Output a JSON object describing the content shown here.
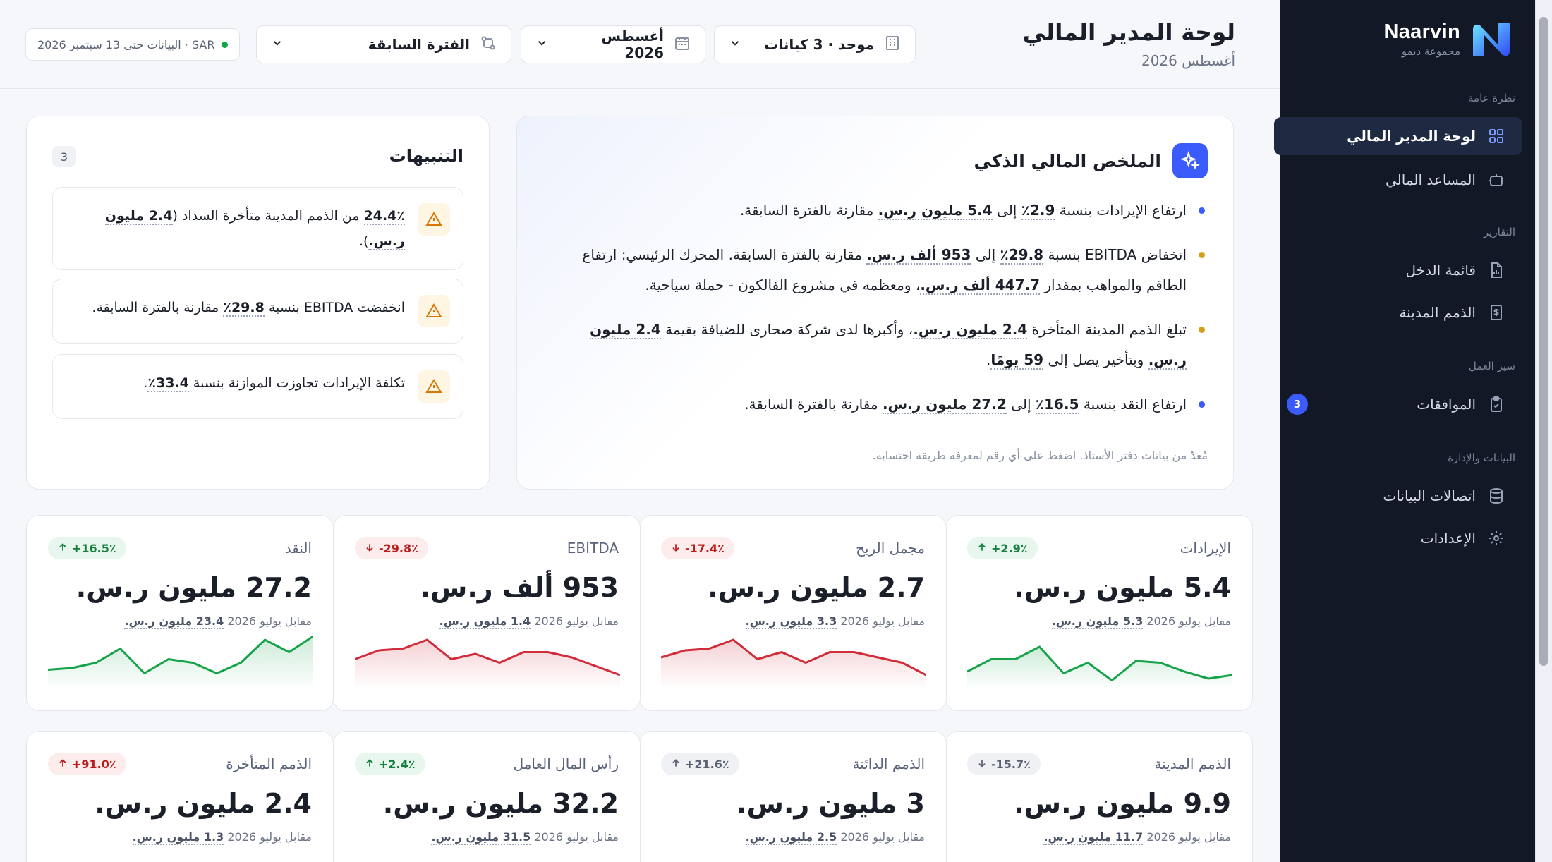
{
  "brand": {
    "name": "Naarvin",
    "subtitle": "مجموعة ديمو"
  },
  "sidebar": {
    "sections": [
      "نظرة عامة",
      "التقارير",
      "سير العمل",
      "البيانات والإدارة"
    ],
    "items": [
      {
        "label": "لوحة المدير المالي",
        "icon": "dashboard-grid-icon"
      },
      {
        "label": "المساعد المالي",
        "icon": "robot-icon"
      },
      {
        "label": "قائمة الدخل",
        "icon": "document-icon"
      },
      {
        "label": "الذمم المدينة",
        "icon": "invoice-icon"
      },
      {
        "label": "الموافقات",
        "icon": "clipboard-check-icon",
        "badge": "3"
      },
      {
        "label": "اتصالات البيانات",
        "icon": "database-icon"
      },
      {
        "label": "الإعدادات",
        "icon": "gear-icon"
      }
    ]
  },
  "header": {
    "title": "لوحة المدير المالي",
    "subtitle": "أغسطس 2026",
    "entity_select": "موحد · 3 كيانات",
    "period_select": "أغسطس 2026",
    "compare_select": "الفترة السابقة",
    "status": "البيانات حتى 13 سبتمبر 2026 · SAR"
  },
  "summary": {
    "title": "الملخص المالي الذكي",
    "items": [
      {
        "color": "#3b5bfd",
        "pre": "ارتفاع الإيرادات بنسبة ",
        "b1": "2.9٪",
        "mid1": " إلى ",
        "b2": "5.4 مليون ر.س.",
        "post": " مقارنة بالفترة السابقة."
      },
      {
        "color": "#d4a017",
        "pre": "انخفاض EBITDA بنسبة ",
        "b1": "29.8٪",
        "mid1": " إلى ",
        "b2": "953 ألف ر.س.",
        "post": " مقارنة بالفترة السابقة. المحرك الرئيسي: ارتفاع الطاقم والمواهب بمقدار ",
        "b3": "447.7 ألف ر.س.",
        "post2": "، ومعظمه في مشروع الفالكون - حملة سياحية."
      },
      {
        "color": "#d4a017",
        "pre": "تبلغ الذمم المدينة المتأخرة ",
        "b1": "2.4 مليون ر.س.",
        "mid1": "، وأكبرها لدى شركة صحارى للضيافة بقيمة ",
        "b2": "2.4 مليون ر.س.",
        "post": " وبتأخير يصل إلى ",
        "b3": "59 يومًا",
        "post2": "."
      },
      {
        "color": "#3b5bfd",
        "pre": "ارتفاع النقد بنسبة ",
        "b1": "16.5٪",
        "mid1": " إلى ",
        "b2": "27.2 مليون ر.س.",
        "post": " مقارنة بالفترة السابقة."
      }
    ],
    "footnote": "مُعدّ من بيانات دفتر الأستاذ. اضغط على أي رقم لمعرفة طريقة احتسابه."
  },
  "alerts": {
    "title": "التنبيهات",
    "count": "3",
    "items": [
      {
        "b": "24.4٪",
        "t1": " من الذمم المدينة متأخرة السداد (",
        "b2": "2.4 مليون ر.س.",
        "t2": ")."
      },
      {
        "t0": "انخفضت EBITDA بنسبة ",
        "b": "29.8٪",
        "t1": " مقارنة بالفترة السابقة."
      },
      {
        "t0": "تكلفة الإيرادات تجاوزت الموازنة بنسبة ",
        "b": "33.4٪",
        "t1": "."
      }
    ]
  },
  "kpis": [
    {
      "label": "الإيرادات",
      "value": "5.4 مليون ر.س.",
      "delta": "+2.9٪",
      "dir": "up",
      "prev_pre": "مقابل يوليو 2026 ",
      "prev": "5.3 مليون ر.س.",
      "color": "#16a34a",
      "spark": [
        20,
        34,
        34,
        48,
        18,
        30,
        10,
        32,
        30,
        20,
        12,
        16
      ]
    },
    {
      "label": "مجمل الربح",
      "value": "2.7 مليون ر.س.",
      "delta": "-17.4٪",
      "dir": "down",
      "prev_pre": "مقابل يوليو 2026 ",
      "prev": "3.3 مليون ر.س.",
      "color": "#d12c3a",
      "spark": [
        36,
        44,
        46,
        56,
        34,
        42,
        30,
        42,
        42,
        36,
        30,
        16
      ]
    },
    {
      "label": "EBITDA",
      "value": "953 ألف ر.س.",
      "delta": "-29.8٪",
      "dir": "down",
      "prev_pre": "مقابل يوليو 2026 ",
      "prev": "1.4 مليون ر.س.",
      "color": "#d12c3a",
      "spark": [
        34,
        44,
        46,
        56,
        34,
        40,
        30,
        42,
        42,
        36,
        26,
        16
      ]
    },
    {
      "label": "النقد",
      "value": "27.2 مليون ر.س.",
      "delta": "+16.5٪",
      "dir": "up",
      "prev_pre": "مقابل يوليو 2026 ",
      "prev": "23.4 مليون ر.س.",
      "color": "#16a34a",
      "spark": [
        22,
        24,
        30,
        46,
        18,
        34,
        30,
        18,
        30,
        56,
        42,
        60
      ]
    },
    {
      "label": "الذمم المدينة",
      "value": "9.9 مليون ر.س.",
      "delta": "-15.7٪",
      "dir": "neutral",
      "prev_pre": "مقابل يوليو 2026 ",
      "prev": "11.7 مليون ر.س."
    },
    {
      "label": "الذمم الدائنة",
      "value": "3 مليون ر.س.",
      "delta": "+21.6٪",
      "dir": "neutral_up",
      "prev_pre": "مقابل يوليو 2026 ",
      "prev": "2.5 مليون ر.س."
    },
    {
      "label": "رأس المال العامل",
      "value": "32.2 مليون ر.س.",
      "delta": "+2.4٪",
      "dir": "up",
      "prev_pre": "مقابل يوليو 2026 ",
      "prev": "31.5 مليون ر.س."
    },
    {
      "label": "الذمم المتأخرة",
      "value": "2.4 مليون ر.س.",
      "delta": "+91.0٪",
      "dir": "up_bad",
      "prev_pre": "مقابل يوليو 2026 ",
      "prev": "1.3 مليون ر.س."
    }
  ]
}
